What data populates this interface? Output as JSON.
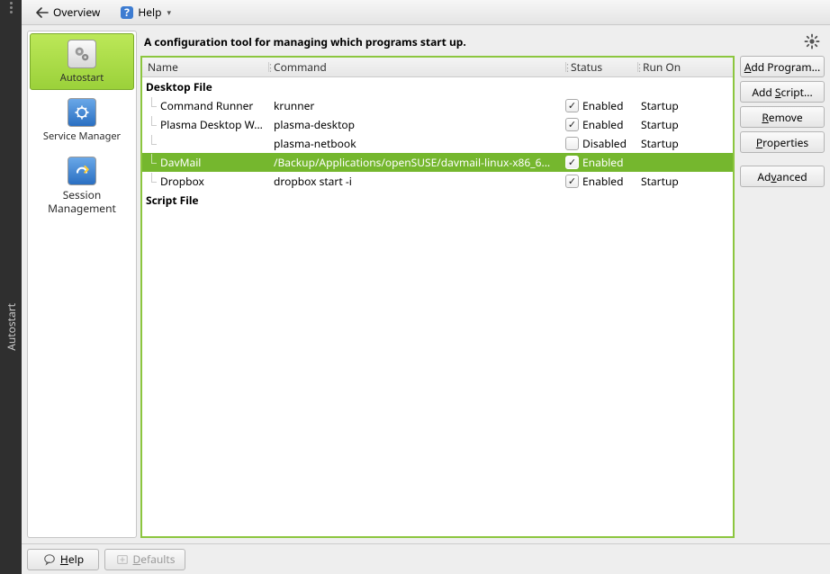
{
  "vert_label": "Autostart",
  "toolbar": {
    "overview": "Overview",
    "help": "Help"
  },
  "sidebar": {
    "items": [
      {
        "label": "Autostart",
        "icon": "gears"
      },
      {
        "label": "Service Manager",
        "icon": "service"
      },
      {
        "label": "Session Management",
        "icon": "session",
        "multiline": true,
        "line1": "Session",
        "line2": "Management"
      }
    ]
  },
  "heading": "A configuration tool for managing which programs start up.",
  "columns": {
    "name": "Name",
    "command": "Command",
    "status": "Status",
    "runon": "Run On"
  },
  "groups": {
    "desktop": "Desktop File",
    "script": "Script File"
  },
  "status_labels": {
    "enabled": "Enabled",
    "disabled": "Disabled"
  },
  "rows": [
    {
      "name": "Command Runner",
      "command": "krunner",
      "checked": true,
      "status": "Enabled",
      "runon": "Startup"
    },
    {
      "name": "Plasma Desktop W...",
      "command": "plasma-desktop",
      "checked": true,
      "status": "Enabled",
      "runon": "Startup"
    },
    {
      "name": "",
      "command": "plasma-netbook",
      "checked": false,
      "status": "Disabled",
      "runon": "Startup"
    },
    {
      "name": "DavMail",
      "command": "/Backup/Applications/openSUSE/davmail-linux-x86_6...",
      "checked": true,
      "status": "Enabled",
      "runon": ""
    },
    {
      "name": "Dropbox",
      "command": "dropbox start -i",
      "checked": true,
      "status": "Enabled",
      "runon": "Startup"
    }
  ],
  "actions": {
    "add_program": "Add Program...",
    "add_script": "Add Script...",
    "remove": "Remove",
    "properties": "Properties",
    "advanced": "Advanced"
  },
  "footer": {
    "help": "Help",
    "defaults": "Defaults"
  }
}
